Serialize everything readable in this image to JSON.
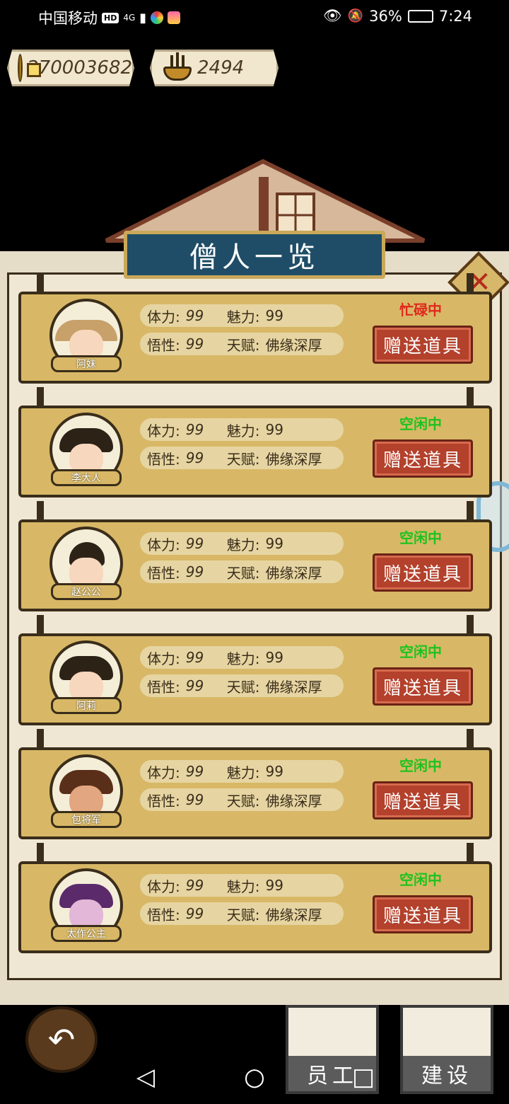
{
  "status_bar": {
    "carrier": "中国移动",
    "hd": "HD",
    "network": "4G",
    "battery": "36%",
    "time": "7:24"
  },
  "currency": {
    "coins": "270003682",
    "incense": "2494"
  },
  "panel": {
    "title": "僧人一览",
    "close_label": "✕"
  },
  "labels": {
    "stamina": "体力:",
    "charm": "魅力:",
    "wisdom": "悟性:",
    "talent": "天赋:",
    "gift_button": "赠送道具"
  },
  "colors": {
    "busy": "#e0281c",
    "idle": "#1ec21e"
  },
  "monks": [
    {
      "name": "阿妹",
      "status": "忙碌中",
      "status_type": "busy",
      "stamina": "99",
      "charm": "99",
      "wisdom": "99",
      "talent": "佛缘深厚"
    },
    {
      "name": "李大人",
      "status": "空闲中",
      "status_type": "idle",
      "stamina": "99",
      "charm": "99",
      "wisdom": "99",
      "talent": "佛缘深厚"
    },
    {
      "name": "赵公公",
      "status": "空闲中",
      "status_type": "idle",
      "stamina": "99",
      "charm": "99",
      "wisdom": "99",
      "talent": "佛缘深厚"
    },
    {
      "name": "阿莉",
      "status": "空闲中",
      "status_type": "idle",
      "stamina": "99",
      "charm": "99",
      "wisdom": "99",
      "talent": "佛缘深厚"
    },
    {
      "name": "包将军",
      "status": "空闲中",
      "status_type": "idle",
      "stamina": "99",
      "charm": "99",
      "wisdom": "99",
      "talent": "佛缘深厚"
    },
    {
      "name": "太作公主",
      "status": "空闲中",
      "status_type": "idle",
      "stamina": "99",
      "charm": "99",
      "wisdom": "99",
      "talent": "佛缘深厚"
    }
  ],
  "bottom": {
    "back_icon": "↶",
    "staff_label": "员工",
    "build_label": "建设"
  },
  "nav": {
    "back": "◁",
    "home": "○",
    "recent": "□"
  }
}
